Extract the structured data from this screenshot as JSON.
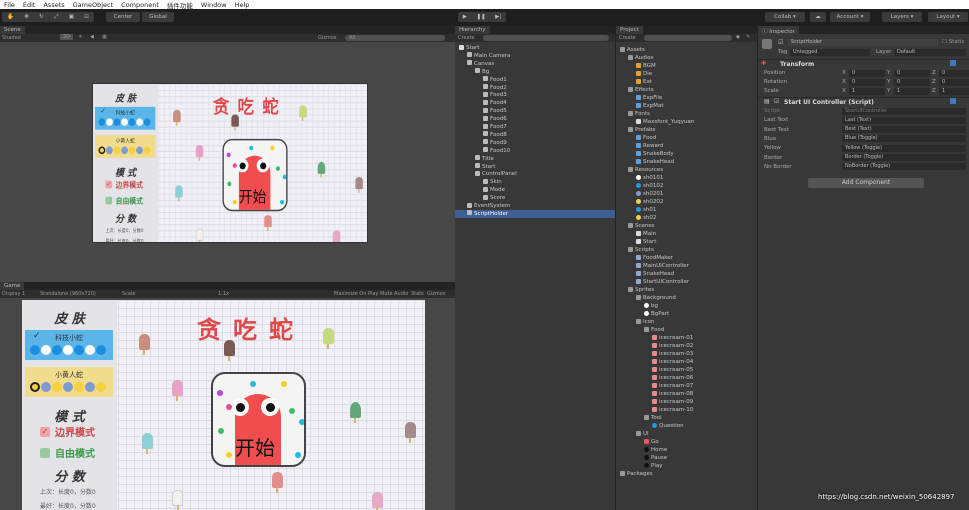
{
  "menu": [
    "File",
    "Edit",
    "Assets",
    "GameObject",
    "Component",
    "插件功能",
    "Window",
    "Help"
  ],
  "toolbar": {
    "tools": [
      "hand-tool",
      "move-tool",
      "rotate-tool",
      "scale-tool",
      "rect-tool",
      "transform-tool"
    ],
    "pivot": "Center",
    "space": "Global",
    "collab": "Collab",
    "account": "Account",
    "layers": "Layers",
    "layout": "Layout"
  },
  "scene": {
    "tab": "Scene",
    "shading": "Shaded",
    "mode2d": "2D",
    "gizmos": "Gizmos",
    "search": "All"
  },
  "game": {
    "tab": "Game",
    "display": "Display 1",
    "resolution": "Standalone (960x720)",
    "scale_label": "Scale",
    "scale_value": "1.1x",
    "maximize": "Maximize On Play",
    "mute": "Mute Audio",
    "stats": "Stats",
    "gizmos": "Gizmos"
  },
  "game_ui": {
    "title": "贪吃蛇",
    "skin_heading": "皮 肤",
    "skin1": "科技小蛇",
    "skin2": "小黄人蛇",
    "mode_heading": "模 式",
    "mode1": "边界模式",
    "mode2": "自由模式",
    "score_heading": "分 数",
    "last": "上次：长度0，分数0",
    "best": "最好：长度0，分数0",
    "start": "开始",
    "colors": {
      "title": "#e0484a",
      "skin1_bg": "#5bb5e8",
      "skin2_bg": "#f0dc8c",
      "snake": "#f04e4e"
    }
  },
  "hierarchy": {
    "tab": "Hierarchy",
    "create": "Create",
    "items": [
      {
        "label": "Start",
        "depth": 0,
        "icon": "unity-scene"
      },
      {
        "label": "Main Camera",
        "depth": 1
      },
      {
        "label": "Canvas",
        "depth": 1
      },
      {
        "label": "Bg",
        "depth": 2
      },
      {
        "label": "Food1",
        "depth": 3
      },
      {
        "label": "Food2",
        "depth": 3
      },
      {
        "label": "Food3",
        "depth": 3
      },
      {
        "label": "Food4",
        "depth": 3
      },
      {
        "label": "Food5",
        "depth": 3
      },
      {
        "label": "Food6",
        "depth": 3
      },
      {
        "label": "Food7",
        "depth": 3
      },
      {
        "label": "Food8",
        "depth": 3
      },
      {
        "label": "Food9",
        "depth": 3
      },
      {
        "label": "Food10",
        "depth": 3
      },
      {
        "label": "Title",
        "depth": 2
      },
      {
        "label": "Start",
        "depth": 2
      },
      {
        "label": "ControlPanel",
        "depth": 2
      },
      {
        "label": "Skin",
        "depth": 3
      },
      {
        "label": "Mode",
        "depth": 3
      },
      {
        "label": "Score",
        "depth": 3
      },
      {
        "label": "EventSystem",
        "depth": 1
      },
      {
        "label": "ScriptHolder",
        "depth": 1,
        "selected": true
      }
    ]
  },
  "project": {
    "tab": "Project",
    "create": "Create",
    "items": [
      {
        "label": "Assets",
        "depth": 0,
        "icon": "folder"
      },
      {
        "label": "Audios",
        "depth": 1,
        "icon": "folder"
      },
      {
        "label": "BGM",
        "depth": 2,
        "icon": "audio"
      },
      {
        "label": "Die",
        "depth": 2,
        "icon": "audio"
      },
      {
        "label": "Eat",
        "depth": 2,
        "icon": "audio"
      },
      {
        "label": "Effects",
        "depth": 1,
        "icon": "folder"
      },
      {
        "label": "ExpFile",
        "depth": 2,
        "icon": "prefab"
      },
      {
        "label": "ExpMat",
        "depth": 2,
        "icon": "prefab"
      },
      {
        "label": "Fonts",
        "depth": 1,
        "icon": "folder"
      },
      {
        "label": "Maxsfont_Yuqyuan",
        "depth": 2,
        "icon": "font"
      },
      {
        "label": "Prefabs",
        "depth": 1,
        "icon": "folder"
      },
      {
        "label": "Food",
        "depth": 2,
        "icon": "prefab"
      },
      {
        "label": "Reward",
        "depth": 2,
        "icon": "prefab"
      },
      {
        "label": "SnakeBody",
        "depth": 2,
        "icon": "prefab"
      },
      {
        "label": "SnakeHead",
        "depth": 2,
        "icon": "prefab"
      },
      {
        "label": "Resources",
        "depth": 1,
        "icon": "folder"
      },
      {
        "label": "sh0101",
        "depth": 2,
        "icon": "white"
      },
      {
        "label": "sh0102",
        "depth": 2,
        "icon": "blue"
      },
      {
        "label": "sh0201",
        "depth": 2,
        "icon": "grayblue"
      },
      {
        "label": "sh0202",
        "depth": 2,
        "icon": "yellow"
      },
      {
        "label": "sh01",
        "depth": 2,
        "icon": "blue"
      },
      {
        "label": "sh02",
        "depth": 2,
        "icon": "yellow"
      },
      {
        "label": "Scenes",
        "depth": 1,
        "icon": "folder"
      },
      {
        "label": "Main",
        "depth": 2,
        "icon": "unity-scene"
      },
      {
        "label": "Start",
        "depth": 2,
        "icon": "unity-scene"
      },
      {
        "label": "Scripts",
        "depth": 1,
        "icon": "folder"
      },
      {
        "label": "FoodMaker",
        "depth": 2,
        "icon": "script"
      },
      {
        "label": "MainUIController",
        "depth": 2,
        "icon": "script"
      },
      {
        "label": "SnakeHead",
        "depth": 2,
        "icon": "script"
      },
      {
        "label": "StartUIController",
        "depth": 2,
        "icon": "script"
      },
      {
        "label": "Sprites",
        "depth": 1,
        "icon": "folder"
      },
      {
        "label": "Background",
        "depth": 2,
        "icon": "folder"
      },
      {
        "label": "bg",
        "depth": 3,
        "icon": "white"
      },
      {
        "label": "BgPart",
        "depth": 3,
        "icon": "white"
      },
      {
        "label": "Icon",
        "depth": 2,
        "icon": "folder"
      },
      {
        "label": "Food",
        "depth": 3,
        "icon": "folder"
      },
      {
        "label": "icecream-01",
        "depth": 4,
        "icon": "ice"
      },
      {
        "label": "icecream-02",
        "depth": 4,
        "icon": "ice"
      },
      {
        "label": "icecream-03",
        "depth": 4,
        "icon": "ice"
      },
      {
        "label": "icecream-04",
        "depth": 4,
        "icon": "ice"
      },
      {
        "label": "icecream-05",
        "depth": 4,
        "icon": "ice"
      },
      {
        "label": "icecream-06",
        "depth": 4,
        "icon": "ice"
      },
      {
        "label": "icecream-07",
        "depth": 4,
        "icon": "ice"
      },
      {
        "label": "icecream-08",
        "depth": 4,
        "icon": "ice"
      },
      {
        "label": "icecream-09",
        "depth": 4,
        "icon": "ice"
      },
      {
        "label": "icecream-10",
        "depth": 4,
        "icon": "ice"
      },
      {
        "label": "Tool",
        "depth": 3,
        "icon": "folder"
      },
      {
        "label": "Question",
        "depth": 4,
        "icon": "blue"
      },
      {
        "label": "UI",
        "depth": 2,
        "icon": "folder"
      },
      {
        "label": "Go",
        "depth": 3,
        "icon": "red"
      },
      {
        "label": "Home",
        "depth": 3,
        "icon": "black"
      },
      {
        "label": "Pause",
        "depth": 3,
        "icon": "black"
      },
      {
        "label": "Play",
        "depth": 3,
        "icon": "black"
      },
      {
        "label": "Packages",
        "depth": 0,
        "icon": "folder"
      }
    ]
  },
  "inspector": {
    "tab": "Inspector",
    "object_name": "ScriptHolder",
    "static": "Static",
    "tag_label": "Tag",
    "tag": "Untagged",
    "layer_label": "Layer",
    "layer": "Default",
    "transform": {
      "title": "Transform",
      "rows": [
        {
          "label": "Position",
          "x": "0",
          "y": "0",
          "z": "0"
        },
        {
          "label": "Rotation",
          "x": "0",
          "y": "0",
          "z": "0"
        },
        {
          "label": "Scale",
          "x": "1",
          "y": "1",
          "z": "1"
        }
      ]
    },
    "script": {
      "title": "Start UI Controller (Script)",
      "rows": [
        {
          "label": "Script",
          "value": "StartUIController"
        },
        {
          "label": "Last Text",
          "value": "Last (Text)"
        },
        {
          "label": "Best Text",
          "value": "Best (Text)"
        },
        {
          "label": "Blue",
          "value": "Blue (Toggle)"
        },
        {
          "label": "Yellow",
          "value": "Yellow (Toggle)"
        },
        {
          "label": "Border",
          "value": "Border (Toggle)"
        },
        {
          "label": "No Border",
          "value": "NoBorder (Toggle)"
        }
      ]
    },
    "add_component": "Add Component"
  },
  "watermark": "https://blog.csdn.net/weixin_50642897"
}
